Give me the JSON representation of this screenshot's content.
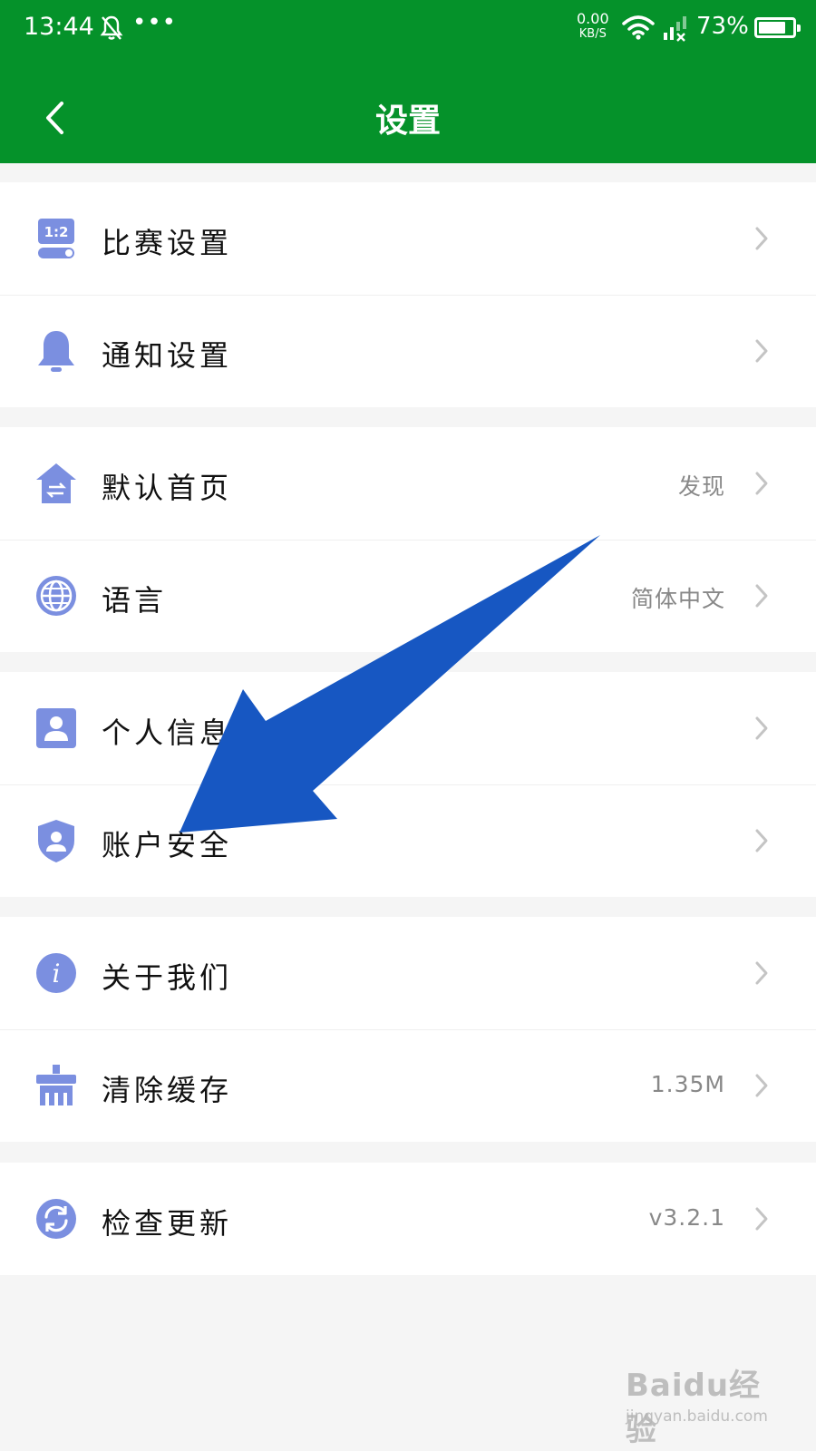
{
  "status_bar": {
    "time": "13:44",
    "dots": "•••",
    "net_speed": "0.00",
    "net_unit": "KB/S",
    "battery": "73%",
    "battery_level": 0.73
  },
  "header": {
    "title": "设置",
    "background": "#05922a"
  },
  "groups": [
    {
      "items": [
        {
          "label": "比赛设置",
          "icon": "match-score-icon",
          "value": "",
          "icon_text": "1:2"
        },
        {
          "label": "通知设置",
          "icon": "bell-icon",
          "value": ""
        }
      ]
    },
    {
      "items": [
        {
          "label": "默认首页",
          "icon": "home-switch-icon",
          "value": "发现"
        },
        {
          "label": "语言",
          "icon": "globe-icon",
          "value": "简体中文"
        }
      ]
    },
    {
      "items": [
        {
          "label": "个人信息",
          "icon": "person-card-icon",
          "value": ""
        },
        {
          "label": "账户安全",
          "icon": "shield-user-icon",
          "value": ""
        }
      ]
    },
    {
      "items": [
        {
          "label": "关于我们",
          "icon": "info-icon",
          "value": "",
          "icon_text": "i"
        },
        {
          "label": "清除缓存",
          "icon": "broom-icon",
          "value": "1.35M"
        }
      ]
    },
    {
      "items": [
        {
          "label": "检查更新",
          "icon": "refresh-icon",
          "value": "v3.2.1"
        }
      ]
    }
  ],
  "icon_color": "#7b8fe0",
  "arrow_color": "#1757c2",
  "watermark": {
    "main": "Baidu经验",
    "sub": "jingyan.baidu.com"
  }
}
